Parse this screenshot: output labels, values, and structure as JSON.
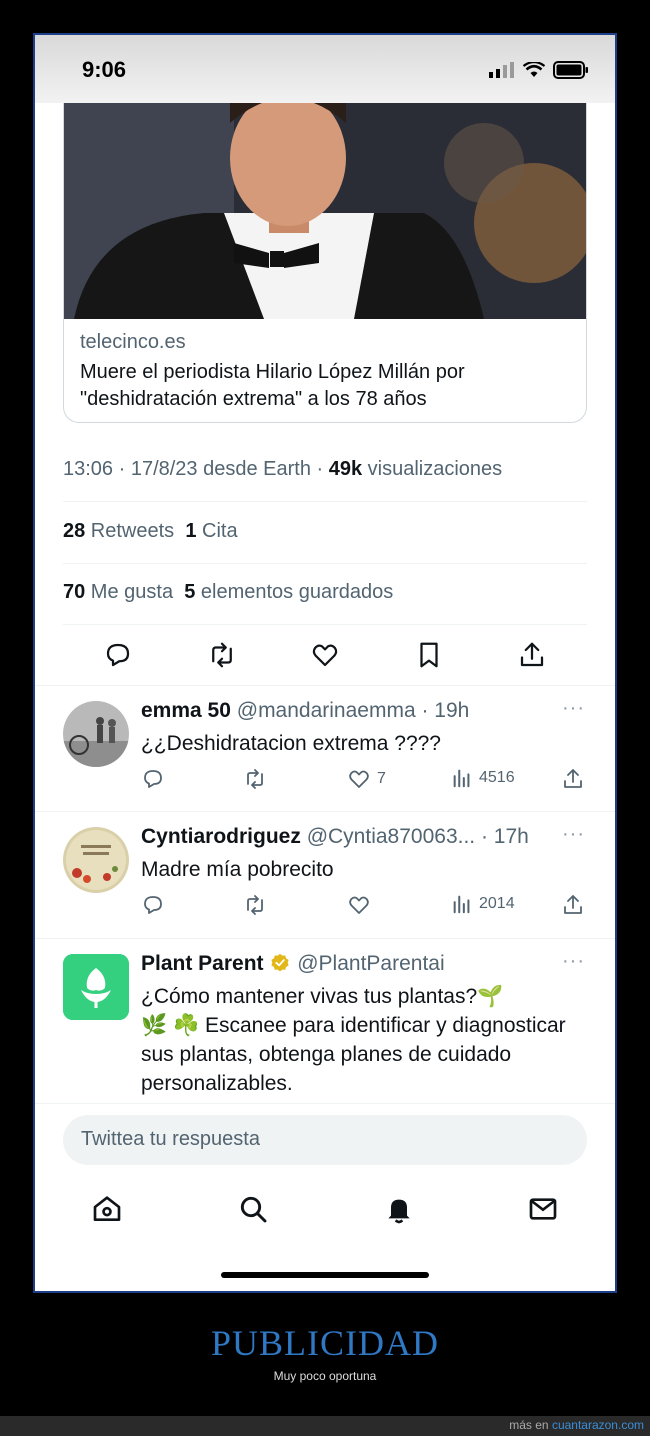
{
  "status_bar": {
    "time": "9:06"
  },
  "card": {
    "domain": "telecinco.es",
    "headline": "Muere el periodista Hilario López Millán por \"deshidratación extrema\" a los 78 años"
  },
  "tweet_meta": {
    "timestamp": "13:06 · 17/8/23 desde Earth · ",
    "views_count": "49k",
    "views_label": " visualizaciones"
  },
  "stats": {
    "retweets_count": "28",
    "retweets_label": " Retweets",
    "quotes_count": "1",
    "quotes_label": " Cita",
    "likes_count": "70",
    "likes_label": " Me gusta",
    "bookmarks_count": "5",
    "bookmarks_label": " elementos guardados"
  },
  "replies": [
    {
      "name": "emma 50",
      "handle": "@mandarinaemma · 19h",
      "text": "¿¿Deshidratacion extrema ????",
      "likes": "7",
      "views": "4516",
      "more": "···"
    },
    {
      "name": "Cyntiarodriguez",
      "handle": "@Cyntia870063... · 17h",
      "text": "Madre mía pobrecito",
      "likes": "",
      "views": "2014",
      "more": "···"
    }
  ],
  "ad": {
    "name": "Plant Parent",
    "handle": "@PlantParentai",
    "text_line1": "¿Cómo mantener vivas tus plantas?🌱",
    "text_line2": "🌿 ☘️ Escanee para identificar y diagnosticar sus plantas, obtenga planes de cuidado personalizables.",
    "more": "···"
  },
  "reply_input": {
    "placeholder": "Twittea tu respuesta"
  },
  "caption": {
    "title": "PUBLICIDAD",
    "subtitle": "Muy poco oportuna"
  },
  "footer": {
    "prefix": "más en ",
    "link": "cuantarazon.com"
  },
  "colors": {
    "accent": "#1d9bf0",
    "text": "#0f1419",
    "muted": "#536471",
    "verified": "#e2b719",
    "caption": "#2f78c4"
  }
}
